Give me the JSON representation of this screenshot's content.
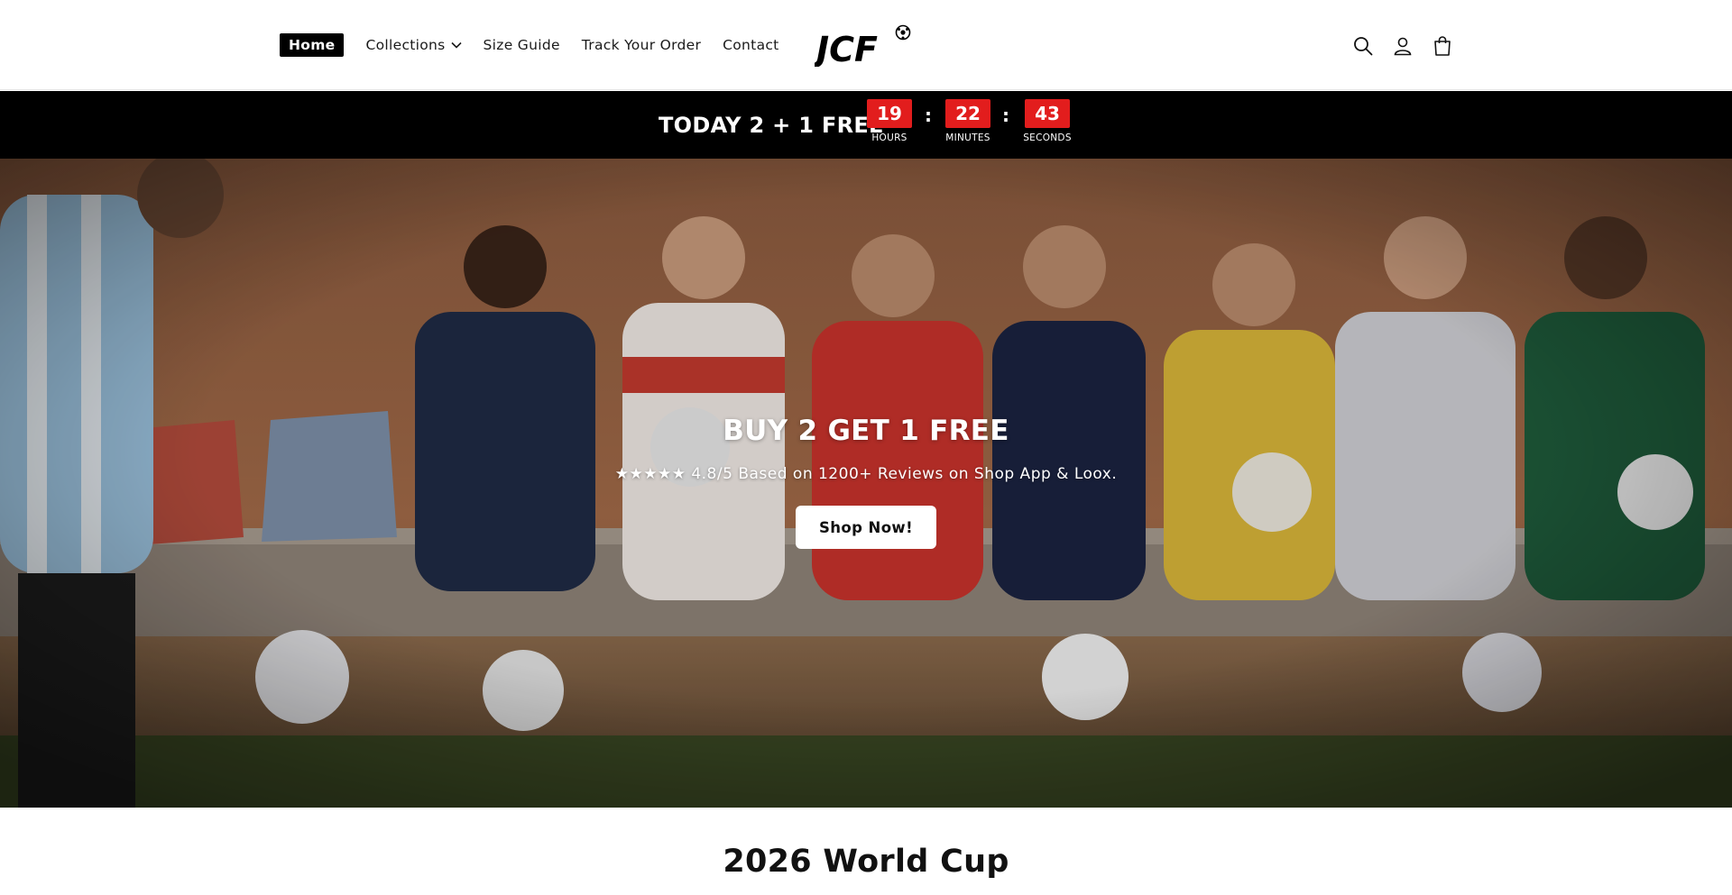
{
  "header": {
    "nav": [
      {
        "label": "Home",
        "active": true
      },
      {
        "label": "Collections",
        "has_dropdown": true
      },
      {
        "label": "Size Guide"
      },
      {
        "label": "Track Your Order"
      },
      {
        "label": "Contact"
      }
    ],
    "logo_text": "JCF",
    "icons": [
      "search-icon",
      "account-icon",
      "cart-icon"
    ]
  },
  "countdown": {
    "promo_text": "TODAY 2 + 1 FREE",
    "hours": "19",
    "hours_label": "HOURS",
    "minutes": "22",
    "minutes_label": "MINUTES",
    "seconds": "43",
    "seconds_label": "SECONDS",
    "accent_color": "#e21d1d"
  },
  "hero": {
    "title": "BUY 2 GET 1 FREE",
    "subtitle": "★★★★★ 4.8/5 Based on 1200+ Reviews on Shop App & Loox.",
    "button_label": "Shop Now!"
  },
  "section": {
    "title": "2026 World Cup"
  }
}
